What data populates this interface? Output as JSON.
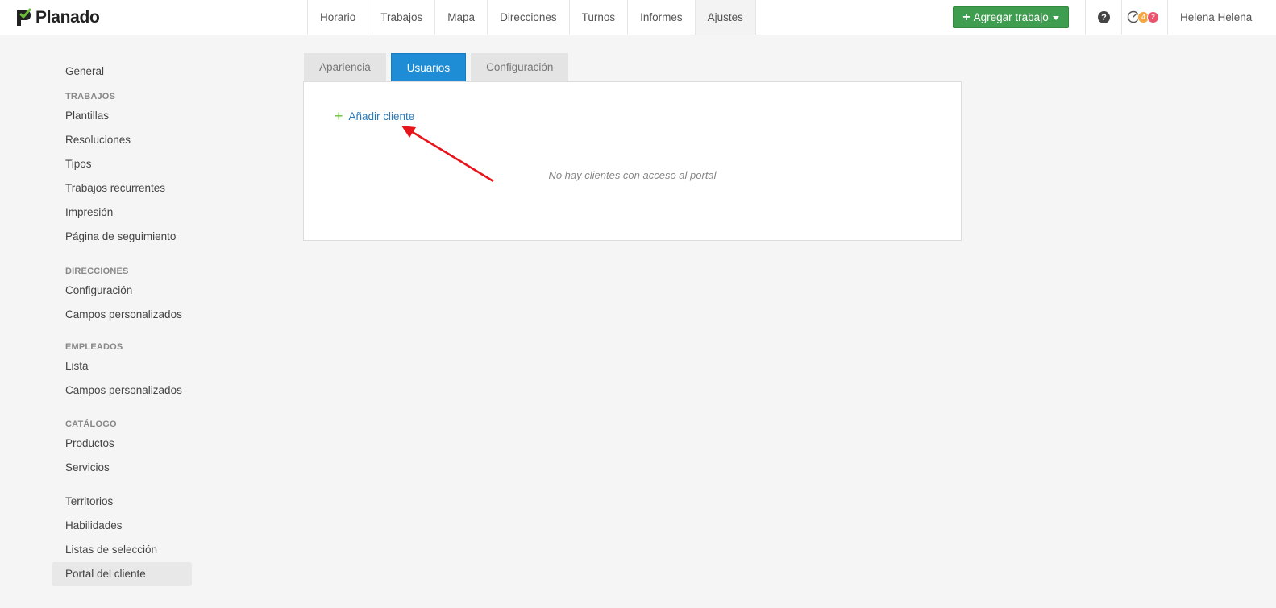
{
  "app": {
    "logo_text": "Planado"
  },
  "nav": {
    "items": [
      {
        "label": "Horario"
      },
      {
        "label": "Trabajos"
      },
      {
        "label": "Mapa"
      },
      {
        "label": "Direcciones"
      },
      {
        "label": "Turnos"
      },
      {
        "label": "Informes"
      },
      {
        "label": "Ajustes",
        "active": true
      }
    ],
    "add_job_label": "Agregar trabajo",
    "help_label": "?",
    "badges": {
      "orange": "4",
      "red": "2"
    },
    "user_name": "Helena Helena"
  },
  "sidebar": {
    "general": "General",
    "sections": [
      {
        "heading": "TRABAJOS",
        "items": [
          "Plantillas",
          "Resoluciones",
          "Tipos",
          "Trabajos recurrentes",
          "Impresión",
          "Página de seguimiento"
        ]
      },
      {
        "heading": "DIRECCIONES",
        "items": [
          "Configuración",
          "Campos personalizados"
        ]
      },
      {
        "heading": "EMPLEADOS",
        "items": [
          "Lista",
          "Campos personalizados"
        ]
      },
      {
        "heading": "CATÁLOGO",
        "items": [
          "Productos",
          "Servicios"
        ]
      }
    ],
    "misc": [
      "Territorios",
      "Habilidades",
      "Listas de selección",
      "Portal del cliente"
    ]
  },
  "tabs": [
    "Apariencia",
    "Usuarios",
    "Configuración"
  ],
  "panel": {
    "add_client_label": "Añadir cliente",
    "empty_message": "No hay clientes con acceso al portal"
  },
  "colors": {
    "accent_blue": "#1f8dd6",
    "button_green": "#3f9d4f",
    "link_blue": "#2a7ab8",
    "annotation_red": "#e8141b"
  }
}
